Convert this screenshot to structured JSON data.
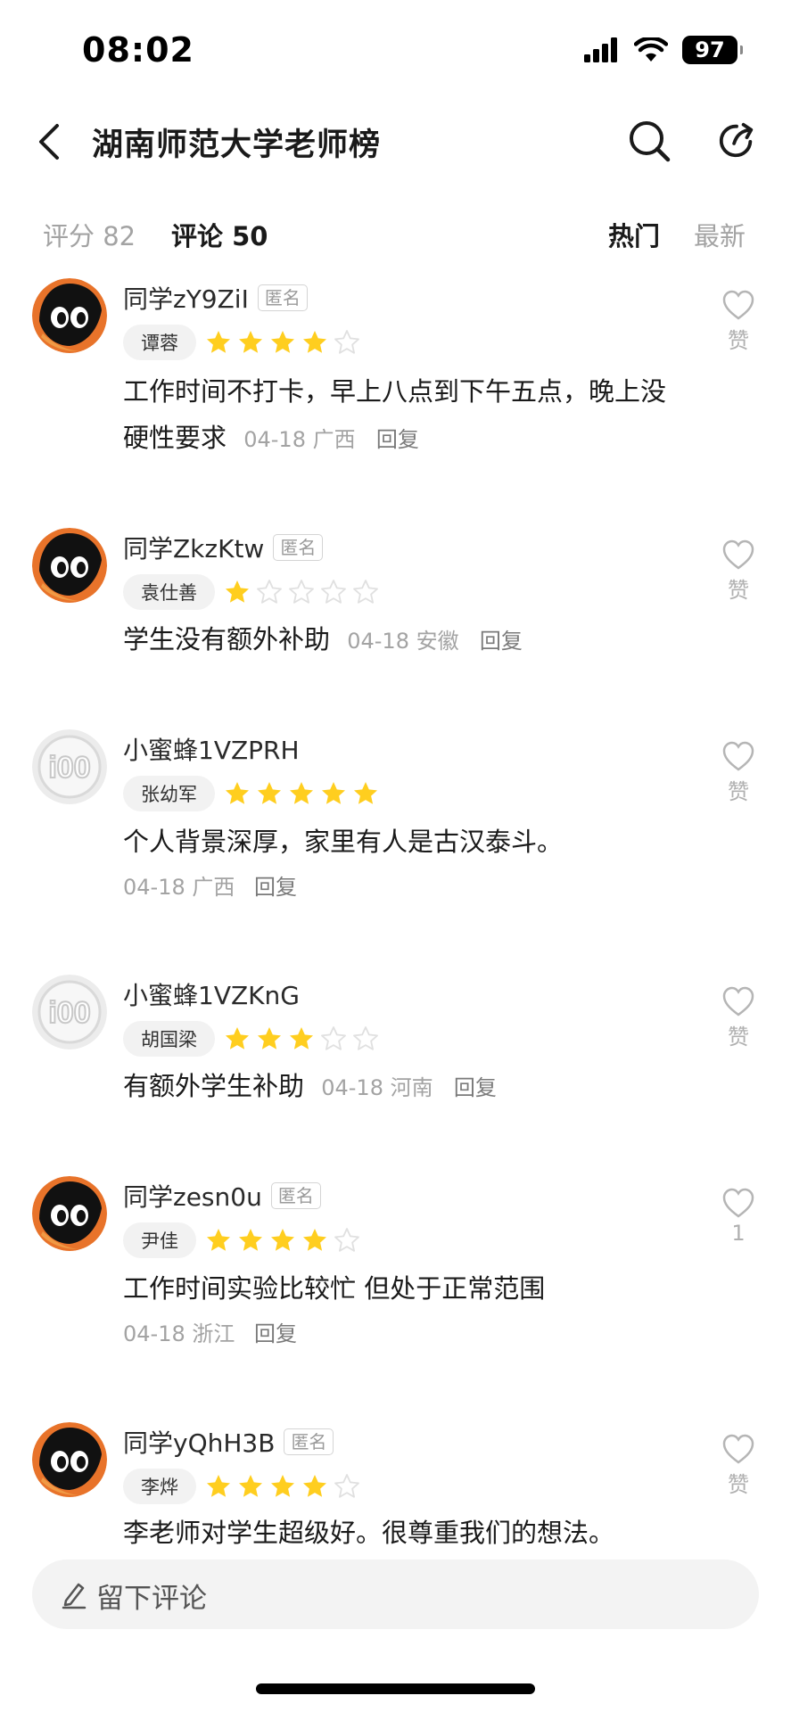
{
  "status_bar": {
    "time": "08:02",
    "battery": "97"
  },
  "nav": {
    "title": "湖南师范大学老师榜"
  },
  "tabs": {
    "rating_label": "评分 82",
    "comments_label": "评论 50",
    "sort_hot": "热门",
    "sort_new": "最新"
  },
  "comments": [
    {
      "username": "同学zY9ZiI",
      "anonymous": "匿名",
      "teacher": "谭蓉",
      "rating": 4,
      "text": "工作时间不打卡，早上八点到下午五点，晚上没硬性要求",
      "date": "04-18",
      "location": "广西",
      "reply": "回复",
      "like_label": "赞",
      "avatar_style": "dark"
    },
    {
      "username": "同学ZkzKtw",
      "anonymous": "匿名",
      "teacher": "袁仕善",
      "rating": 1,
      "text": "学生没有额外补助",
      "date": "04-18",
      "location": "安徽",
      "reply": "回复",
      "like_label": "赞",
      "avatar_style": "dark"
    },
    {
      "username": "小蜜蜂1VZPRH",
      "anonymous": "",
      "teacher": "张幼军",
      "rating": 5,
      "text": "个人背景深厚，家里有人是古汉泰斗。",
      "date": "04-18",
      "location": "广西",
      "reply": "回复",
      "like_label": "赞",
      "avatar_style": "light"
    },
    {
      "username": "小蜜蜂1VZKnG",
      "anonymous": "",
      "teacher": "胡国梁",
      "rating": 3,
      "text": "有额外学生补助",
      "date": "04-18",
      "location": "河南",
      "reply": "回复",
      "like_label": "赞",
      "avatar_style": "light"
    },
    {
      "username": "同学zesn0u",
      "anonymous": "匿名",
      "teacher": "尹佳",
      "rating": 4,
      "text": "工作时间实验比较忙 但处于正常范围",
      "date": "04-18",
      "location": "浙江",
      "reply": "回复",
      "like_label": "1",
      "avatar_style": "dark"
    },
    {
      "username": "同学yQhH3B",
      "anonymous": "匿名",
      "teacher": "李烨",
      "rating": 4,
      "text": "李老师对学生超级好。很尊重我们的想法。",
      "date": "",
      "location": "",
      "reply": "",
      "like_label": "赞",
      "avatar_style": "dark"
    }
  ],
  "comment_bar": {
    "placeholder": "留下评论"
  },
  "colors": {
    "star_filled": "#FFCE1F",
    "star_empty": "#E0E0E0",
    "accent_dark": "#1a1a1a"
  },
  "icons": [
    "back-icon",
    "search-icon",
    "share-icon",
    "heart-icon",
    "pencil-icon",
    "signal-icon",
    "wifi-icon"
  ]
}
